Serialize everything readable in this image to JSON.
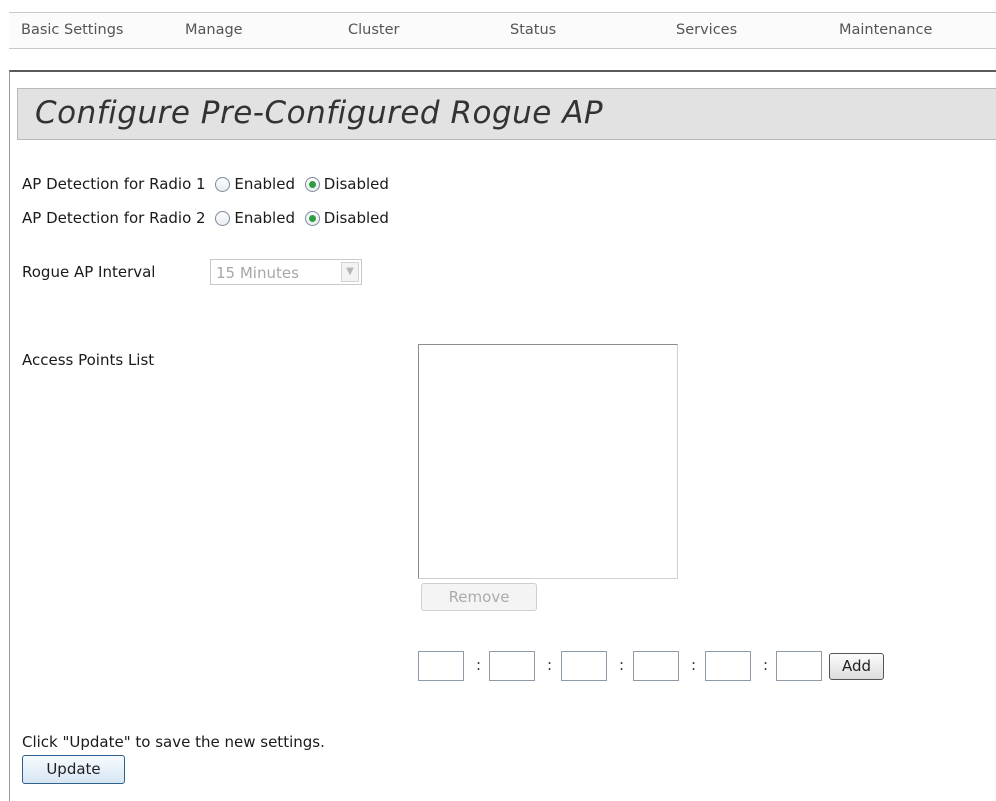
{
  "nav": {
    "items": [
      "Basic Settings",
      "Manage",
      "Cluster",
      "Status",
      "Services",
      "Maintenance"
    ]
  },
  "page": {
    "title": "Configure Pre-Configured Rogue AP"
  },
  "detection": {
    "radio1": {
      "label": "AP Detection for Radio 1",
      "enabled_label": "Enabled",
      "disabled_label": "Disabled",
      "selected": "Disabled"
    },
    "radio2": {
      "label": "AP Detection for Radio 2",
      "enabled_label": "Enabled",
      "disabled_label": "Disabled",
      "selected": "Disabled"
    }
  },
  "interval": {
    "label": "Rogue AP Interval",
    "value": "15 Minutes"
  },
  "ap_list": {
    "label": "Access Points List",
    "items": [],
    "remove_label": "Remove"
  },
  "mac_entry": {
    "separator": ":",
    "fields": [
      "",
      "",
      "",
      "",
      "",
      ""
    ],
    "add_label": "Add"
  },
  "footer": {
    "hint": "Click \"Update\" to save the new settings.",
    "update_label": "Update"
  }
}
